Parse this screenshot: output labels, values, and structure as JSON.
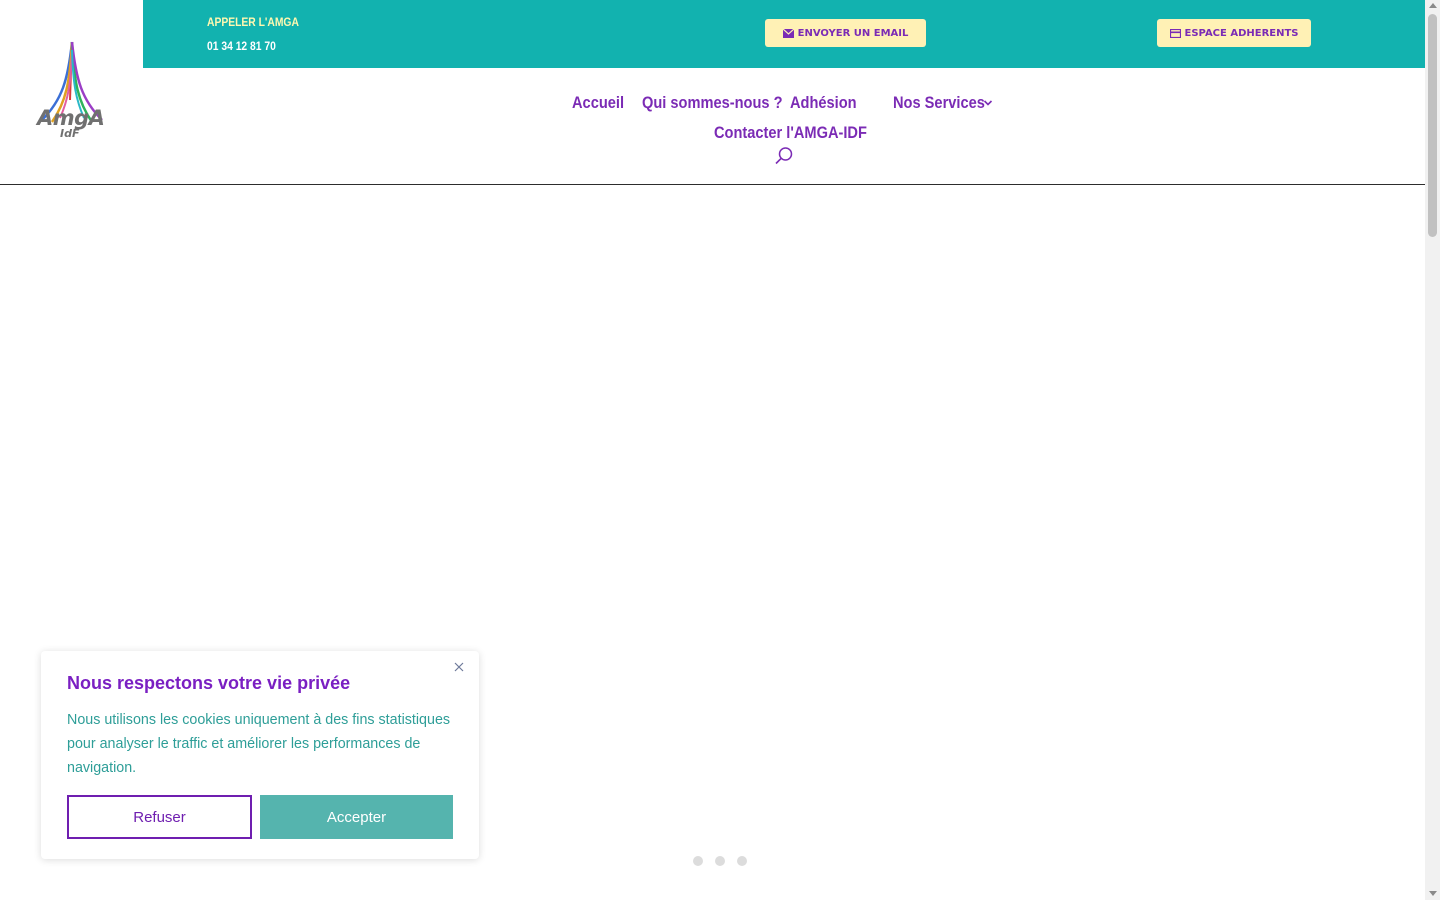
{
  "logo": {
    "text": "AmgA",
    "sub": "IdF"
  },
  "topbar": {
    "call_label": "APPELER L'AMGA",
    "phone": "01 34 12 81 70",
    "email_button": "ENVOYER UN EMAIL",
    "member_button": "ESPACE ADHERENTS",
    "background": "#12b2af",
    "button_color": "#fff1b5"
  },
  "nav": {
    "items": [
      "Accueil",
      "Qui sommes-nous ?",
      "Adhésion",
      "Nos Services",
      "Contacter l'AMGA-IDF"
    ],
    "color": "#7b2bb5"
  },
  "slider": {
    "dots": 3
  },
  "cookie": {
    "title": "Nous respectons votre vie privée",
    "text": "Nous utilisons les cookies uniquement à des fins statistiques pour analyser le traffic et améliorer les performances de navigation.",
    "refuse": "Refuser",
    "accept": "Accepter",
    "title_color": "#7a1fc2",
    "text_color": "#2e9e98",
    "accept_color": "#55b4ae"
  },
  "icons": [
    "envelope-icon",
    "card-icon",
    "chevron-down-icon",
    "search-icon",
    "close-icon"
  ]
}
